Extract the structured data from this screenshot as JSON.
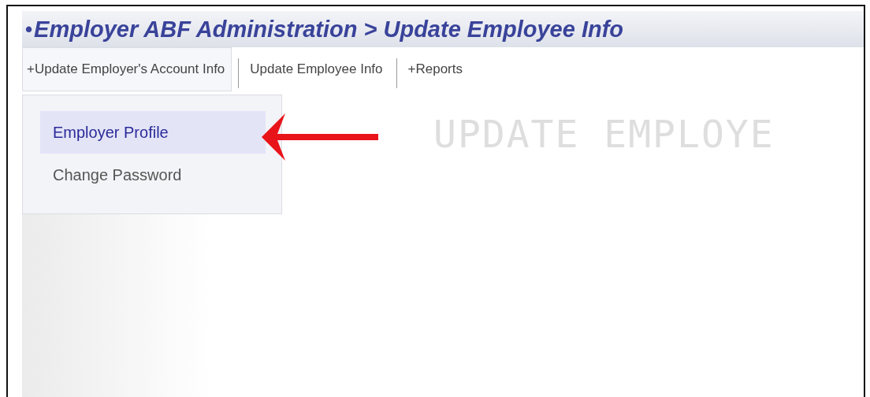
{
  "header": {
    "bullet": "•",
    "title": "Employer ABF Administration > Update Employee Info"
  },
  "tabs": [
    {
      "label": "+Update Employer's Account Info",
      "selected": true
    },
    {
      "label": "Update Employee Info",
      "selected": false
    },
    {
      "label": "+Reports",
      "selected": false
    }
  ],
  "dropdown": {
    "items": [
      {
        "label": "Employer Profile",
        "selected": true
      },
      {
        "label": "Change Password",
        "selected": false
      }
    ]
  },
  "page_heading": "UPDATE EMPLOYE"
}
